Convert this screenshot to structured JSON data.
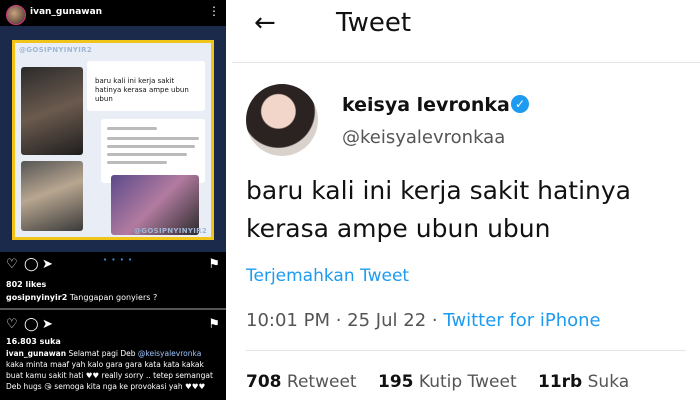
{
  "instagram": {
    "username": "ivan_gunawan",
    "watermark": "@GOSIPNYINYIR2",
    "tweet_in_image": "baru kali ini kerja sakit hatinya kerasa ampe ubun ubun",
    "likes_1": "802 likes",
    "comment_1_user": "gosipnyinyir2",
    "comment_1_text": "Tanggapan gonyiers ?",
    "likes_2": "16.803 suka",
    "caption_user": "ivan_gunawan",
    "caption_text_1": "Selamat pagi Deb",
    "caption_mention": "@keisyalevronka",
    "caption_text_2": "kaka minta maaf yah kalo gara gara kata kata kakak buat kamu sakit hati ♥♥ really sorry .. tetep semangat Deb hugs 😘 semoga kita nga ke provokasi yah ♥♥♥"
  },
  "twitter": {
    "title": "Tweet",
    "name": "keisya levronka",
    "handle": "@keisyalevronkaa",
    "text": "baru kali ini kerja sakit hatinya kerasa ampe ubun ubun",
    "translate": "Terjemahkan Tweet",
    "time": "10:01 PM",
    "date": "25 Jul 22",
    "source": "Twitter for iPhone",
    "retweets_count": "708",
    "retweets_label": "Retweet",
    "quotes_count": "195",
    "quotes_label": "Kutip Tweet",
    "likes_count": "11rb",
    "likes_label": "Suka"
  },
  "colors": {
    "link_blue": "#1d9bf0",
    "ig_bg": "#000000",
    "frame_yellow": "#f0c419"
  }
}
